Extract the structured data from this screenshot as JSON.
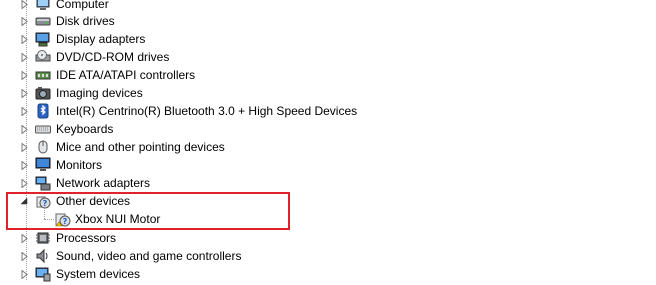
{
  "device_manager": {
    "categories": [
      {
        "label": "Computer",
        "icon": "computer-icon",
        "expanded": false
      },
      {
        "label": "Disk drives",
        "icon": "disk-drive-icon",
        "expanded": false
      },
      {
        "label": "Display adapters",
        "icon": "display-adapter-icon",
        "expanded": false
      },
      {
        "label": "DVD/CD-ROM drives",
        "icon": "dvd-drive-icon",
        "expanded": false
      },
      {
        "label": "IDE ATA/ATAPI controllers",
        "icon": "ide-controller-icon",
        "expanded": false
      },
      {
        "label": "Imaging devices",
        "icon": "camera-icon",
        "expanded": false
      },
      {
        "label": "Intel(R) Centrino(R) Bluetooth 3.0 + High Speed Devices",
        "icon": "bluetooth-radio-icon",
        "expanded": false
      },
      {
        "label": "Keyboards",
        "icon": "keyboard-icon",
        "expanded": false
      },
      {
        "label": "Mice and other pointing devices",
        "icon": "mouse-icon",
        "expanded": false
      },
      {
        "label": "Monitors",
        "icon": "monitor-icon",
        "expanded": false
      },
      {
        "label": "Network adapters",
        "icon": "network-adapter-icon",
        "expanded": false
      },
      {
        "label": "Other devices",
        "icon": "unknown-device-icon",
        "expanded": true
      },
      {
        "label": "Processors",
        "icon": "processor-icon",
        "expanded": false
      },
      {
        "label": "Sound, video and game controllers",
        "icon": "speaker-icon",
        "expanded": false
      },
      {
        "label": "System devices",
        "icon": "system-device-icon",
        "expanded": false
      }
    ],
    "other_devices_children": [
      {
        "label": "Xbox NUI Motor",
        "icon": "unknown-device-warning-icon"
      }
    ],
    "highlight_color": "#e0232b"
  }
}
